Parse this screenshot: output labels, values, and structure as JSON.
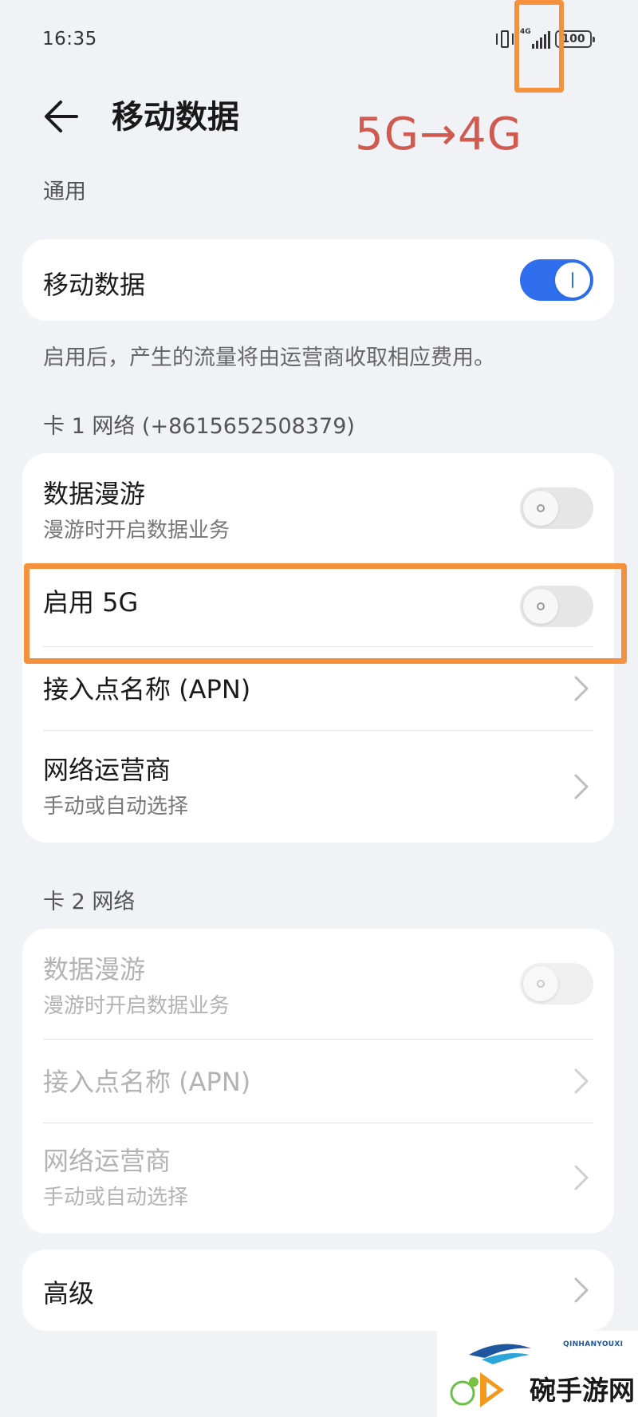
{
  "status_bar": {
    "time": "16:35",
    "signal_tag": "4G",
    "battery": "100"
  },
  "annotations": {
    "change_label": "5G→4G",
    "accent_color": "#f5913d",
    "label_color": "#d05a4f"
  },
  "header": {
    "title": "移动数据"
  },
  "general": {
    "label": "通用",
    "mobile_data": {
      "title": "移动数据",
      "enabled": true
    },
    "note": "启用后，产生的流量将由运营商收取相应费用。"
  },
  "sim1": {
    "label": "卡 1 网络 (+8615652508379)",
    "roaming": {
      "title": "数据漫游",
      "subtitle": "漫游时开启数据业务",
      "enabled": false
    },
    "enable_5g": {
      "title": "启用 5G",
      "enabled": false
    },
    "apn": {
      "title": "接入点名称 (APN)"
    },
    "carrier": {
      "title": "网络运营商",
      "subtitle": "手动或自动选择"
    }
  },
  "sim2": {
    "label": "卡 2 网络",
    "roaming": {
      "title": "数据漫游",
      "subtitle": "漫游时开启数据业务",
      "enabled": false
    },
    "apn": {
      "title": "接入点名称 (APN)"
    },
    "carrier": {
      "title": "网络运营商",
      "subtitle": "手动或自动选择"
    }
  },
  "advanced": {
    "title": "高级"
  },
  "watermark": {
    "tag": "QINHANYOUXI",
    "text": "碗手游网"
  },
  "colors": {
    "toggle_on": "#2f6fed",
    "background": "#f1f2f5"
  }
}
